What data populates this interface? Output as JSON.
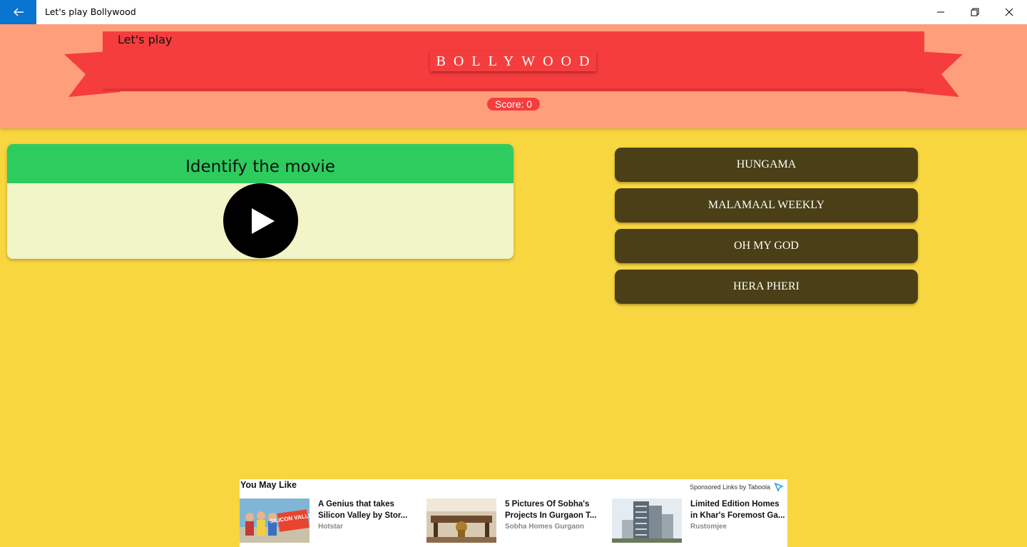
{
  "window": {
    "title": "Let's play Bollywood",
    "icons": {
      "back": "back-arrow-icon",
      "minimize": "minimize-icon",
      "maximize": "restore-icon",
      "close": "close-icon"
    }
  },
  "header": {
    "subtitle": "Let's play",
    "title": "BOLLYWOOD",
    "score": "Score: 0",
    "colors": {
      "background": "#ff9e7b",
      "ribbon": "#f53d3e"
    }
  },
  "question": {
    "prompt": "Identify the movie",
    "play_icon": "play-icon"
  },
  "answers": [
    {
      "label": "HUNGAMA"
    },
    {
      "label": "MALAMAAL WEEKLY"
    },
    {
      "label": "OH MY GOD"
    },
    {
      "label": "HERA PHERI"
    }
  ],
  "ads": {
    "title": "You May Like",
    "sponsor": "Sponsored Links by Taboola",
    "items": [
      {
        "line1": "A Genius that takes",
        "line2": "Silicon Valley by Stor...",
        "source": "Hotstar",
        "thumb_text": "SILICON VALLEY"
      },
      {
        "line1": "5 Pictures Of Sobha's",
        "line2": "Projects In Gurgaon T...",
        "source": "Sobha Homes Gurgaon"
      },
      {
        "line1": "Limited Edition Homes",
        "line2": "in Khar's Foremost Ga...",
        "source": "Rustomjee"
      }
    ]
  },
  "colors": {
    "page_bg": "#f8d63f",
    "answer_bg": "#4a3f16",
    "card_head": "#2ecc5f",
    "card_body": "#f1f5c7",
    "titlebar_accent": "#0a74d1"
  }
}
